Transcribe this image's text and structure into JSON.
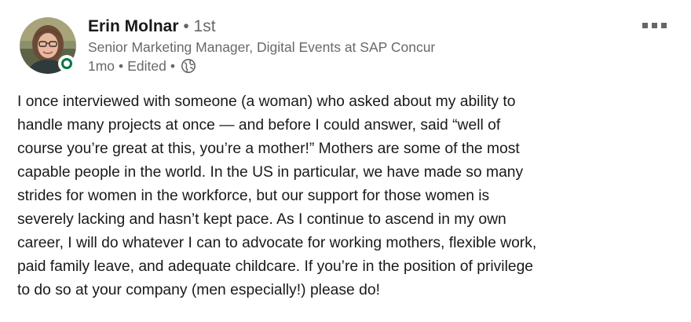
{
  "post": {
    "author": {
      "name": "Erin Molnar",
      "degree": "1st",
      "headline": "Senior Marketing Manager, Digital Events at SAP Concur",
      "time": "1mo",
      "edited": "Edited",
      "visibility_icon": "globe-icon",
      "online": true
    },
    "more_icon": "ellipsis-icon",
    "body_lines": [
      "I once interviewed with someone (a woman) who asked about my ability to",
      "handle many projects at once — and before I could answer, said “well of",
      "course you’re great at this, you’re a mother!” Mothers are some of the most",
      "capable people in the world. In the US in particular, we have made so many",
      "strides for women in the workforce, but our support for those women is",
      "severely lacking and hasn’t kept pace. As I continue to ascend in my own",
      "career, I will do whatever I can to advocate for working mothers, flexible work,",
      "paid family leave, and adequate childcare. If you’re in the position of privilege",
      "to do so at your company (men especially!) please do!"
    ]
  },
  "colors": {
    "text_primary": "#191919",
    "text_secondary": "#666666",
    "online_green": "#057642",
    "background": "#ffffff"
  }
}
